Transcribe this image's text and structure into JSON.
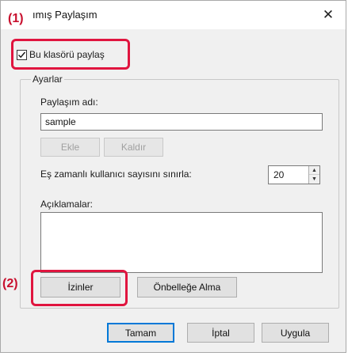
{
  "window": {
    "title": "ımış Paylaşım"
  },
  "callouts": {
    "one": "(1)",
    "two": "(2)"
  },
  "share": {
    "checkbox_label": "Bu klasörü paylaş",
    "checked": true
  },
  "settings": {
    "group_title": "Ayarlar",
    "share_name_label": "Paylaşım adı:",
    "share_name_value": "sample",
    "add_label": "Ekle",
    "remove_label": "Kaldır",
    "limit_label": "Eş zamanlı kullanıcı sayısını sınırla:",
    "limit_value": "20",
    "comments_label": "Açıklamalar:",
    "comments_value": "",
    "permissions_label": "İzinler",
    "caching_label": "Önbelleğe Alma"
  },
  "footer": {
    "ok_label": "Tamam",
    "cancel_label": "İptal",
    "apply_label": "Uygula"
  },
  "colors": {
    "highlight": "#e0153f",
    "callout": "#c8102e",
    "default_button_border": "#0078d7"
  }
}
